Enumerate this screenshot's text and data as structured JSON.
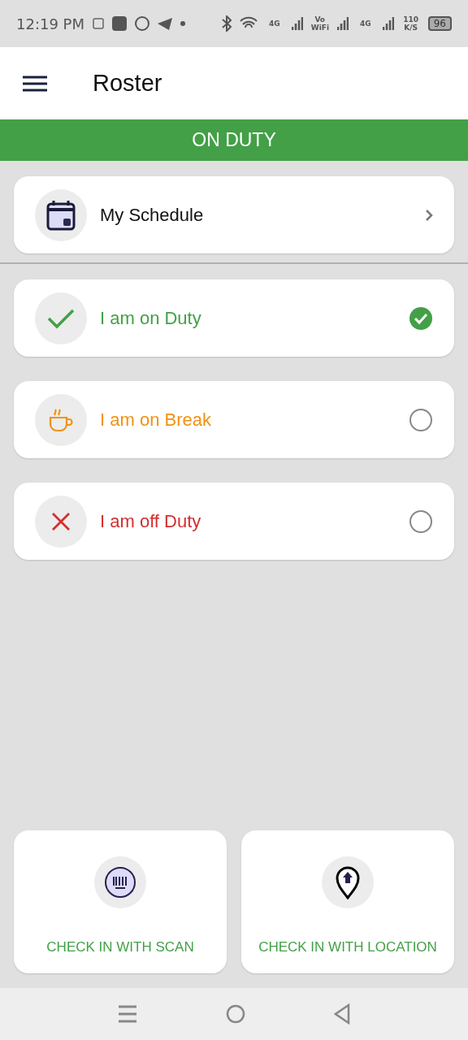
{
  "status_bar": {
    "time": "12:19 PM",
    "network": [
      {
        "kind": "label",
        "text": "4G"
      },
      {
        "kind": "label",
        "text": "Vo WiFi"
      },
      {
        "kind": "label",
        "text": "4G"
      }
    ],
    "speed": "110 K/S",
    "battery": "96"
  },
  "app_bar": {
    "title": "Roster"
  },
  "banner": {
    "text": "ON DUTY"
  },
  "schedule": {
    "label": "My Schedule"
  },
  "options": [
    {
      "kind": "duty",
      "label": "I am on Duty",
      "color": "#43a047",
      "selected": true
    },
    {
      "kind": "break",
      "label": "I am on Break",
      "color": "#f0920f",
      "selected": false
    },
    {
      "kind": "off",
      "label": "I am off Duty",
      "color": "#d32f2f",
      "selected": false
    }
  ],
  "actions": [
    {
      "kind": "scan",
      "label": "CHECK IN WITH SCAN"
    },
    {
      "kind": "location",
      "label": "CHECK IN WITH LOCATION"
    }
  ]
}
